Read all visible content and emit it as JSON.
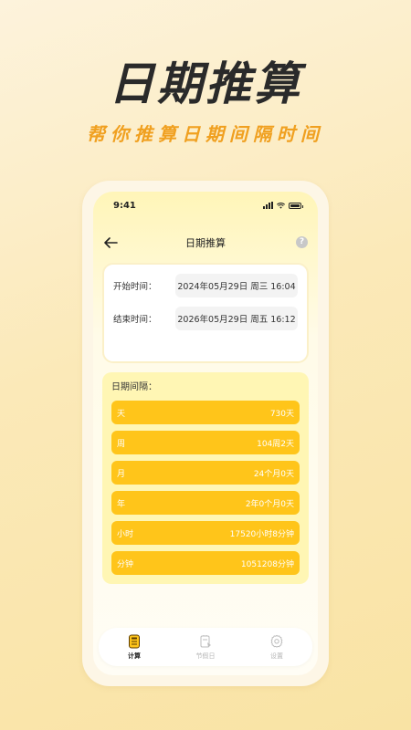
{
  "hero": {
    "title": "日期推算",
    "subtitle": "帮你推算日期间隔时间"
  },
  "status_bar": {
    "time": "9:41"
  },
  "nav": {
    "title": "日期推算",
    "help": "?"
  },
  "time_card": {
    "start_label": "开始时间：",
    "start_value": "2024年05月29日 周三 16:04",
    "end_label": "结束时间：",
    "end_value": "2026年05月29日 周五 16:12"
  },
  "interval": {
    "title": "日期间隔：",
    "rows": [
      {
        "unit": "天",
        "value": "730天"
      },
      {
        "unit": "周",
        "value": "104周2天"
      },
      {
        "unit": "月",
        "value": "24个月0天"
      },
      {
        "unit": "年",
        "value": "2年0个月0天"
      },
      {
        "unit": "小时",
        "value": "17520小时8分钟"
      },
      {
        "unit": "分钟",
        "value": "1051208分钟"
      }
    ]
  },
  "tabs": [
    {
      "label": "计算",
      "icon": "calculator-icon",
      "active": true
    },
    {
      "label": "节假日",
      "icon": "holiday-icon",
      "active": false
    },
    {
      "label": "设置",
      "icon": "gear-icon",
      "active": false
    }
  ],
  "colors": {
    "accent": "#ffc51a",
    "subtitle": "#f0a020",
    "interval_bg": "#fff6b4"
  }
}
